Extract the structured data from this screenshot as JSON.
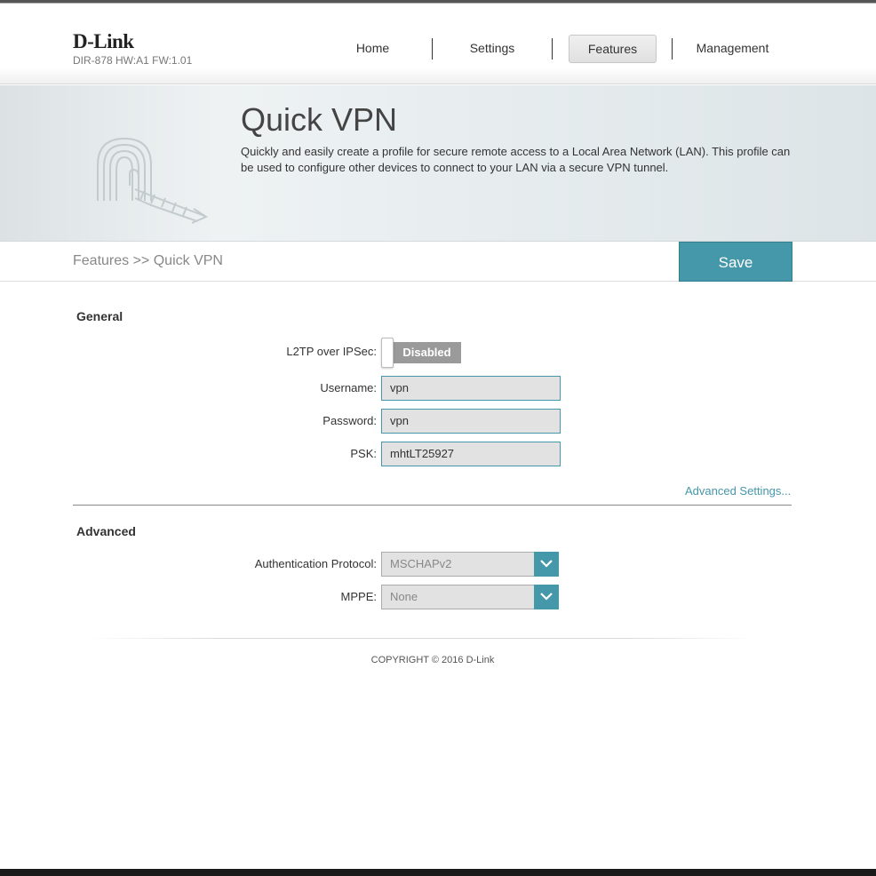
{
  "brand": {
    "logo": "D-Link",
    "model": "DIR-878 HW:A1 FW:1.01"
  },
  "nav": {
    "items": [
      {
        "label": "Home"
      },
      {
        "label": "Settings"
      },
      {
        "label": "Features",
        "active": true
      },
      {
        "label": "Management"
      }
    ]
  },
  "banner": {
    "title": "Quick VPN",
    "description": "Quickly and easily create a profile for secure remote access to a Local Area Network (LAN). This profile can be used to configure other devices to connect to your LAN via a secure VPN tunnel.",
    "icon": "vpn-tunnel-icon"
  },
  "breadcrumb": "Features >> Quick VPN",
  "save_label": "Save",
  "general": {
    "title": "General",
    "l2tp_label": "L2TP over IPSec:",
    "l2tp_state": "Disabled",
    "username_label": "Username:",
    "username_value": "vpn",
    "password_label": "Password:",
    "password_value": "vpn",
    "psk_label": "PSK:",
    "psk_value": "mhtLT25927",
    "advanced_link": "Advanced Settings..."
  },
  "advanced": {
    "title": "Advanced",
    "auth_label": "Authentication Protocol:",
    "auth_value": "MSCHAPv2",
    "mppe_label": "MPPE:",
    "mppe_value": "None"
  },
  "footer": {
    "copyright": "COPYRIGHT © 2016 D-Link"
  },
  "colors": {
    "accent": "#4597aa",
    "toggle_off": "#9a9a9a",
    "field_bg": "#e2e2e2"
  }
}
